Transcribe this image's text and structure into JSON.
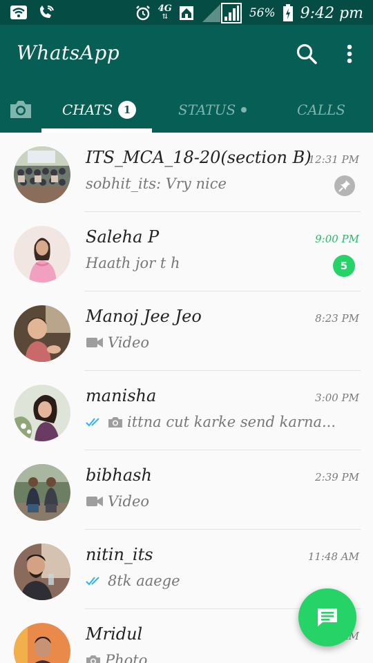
{
  "status_bar": {
    "network": "4G",
    "battery_percent": "56%",
    "time": "9:42 pm",
    "icons": [
      "wifi-icon",
      "wifi-call-icon",
      "alarm-icon",
      "4g-icon",
      "home-icon",
      "signal-icon",
      "battery-icon"
    ]
  },
  "app_bar": {
    "title": "WhatsApp",
    "icons": [
      "search-icon",
      "more-vert-icon"
    ]
  },
  "tabs": {
    "camera_icon": "camera-icon",
    "items": [
      {
        "label": "CHATS",
        "badge": "1",
        "active": true
      },
      {
        "label": "STATUS",
        "active": false
      },
      {
        "label": "CALLS",
        "active": false
      }
    ]
  },
  "chats": [
    {
      "name": "ITS_MCA_18-20(section B)",
      "time": "12:31 PM",
      "preview": "sobhit_its: Vry nice",
      "pinned": true
    },
    {
      "name": "Saleha P",
      "time": "9:00 PM",
      "preview": "Haath jor t h",
      "unread": "5"
    },
    {
      "name": "Manoj Jee Jeo",
      "time": "8:23 PM",
      "preview": "Video",
      "preview_icon": "video-icon"
    },
    {
      "name": "manisha",
      "time": "3:00 PM",
      "preview": "ittna cut karke  send  karna...",
      "preview_icon": "photo-icon",
      "read_receipt": "double-check-icon"
    },
    {
      "name": "bibhash",
      "time": "2:39 PM",
      "preview": "Video",
      "preview_icon": "video-icon"
    },
    {
      "name": "nitin_its",
      "time": "11:48 AM",
      "preview": "8tk  aaege",
      "read_receipt": "double-check-icon"
    },
    {
      "name": "Mridul",
      "time": "AM",
      "preview": "Photo",
      "preview_icon": "photo-icon"
    }
  ],
  "fab": {
    "icon": "new-chat-icon"
  },
  "colors": {
    "primary": "#075e54",
    "status_bar": "#054d44",
    "accent": "#25d366",
    "read_receipt": "#34b7f1"
  }
}
